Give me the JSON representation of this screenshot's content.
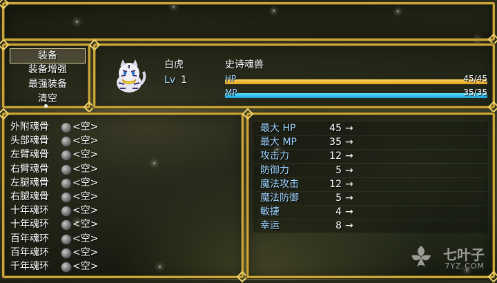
{
  "commands": [
    "装备",
    "装备增强",
    "最强装备",
    "清空"
  ],
  "actor": {
    "name": "白虎",
    "level_label": "Lv",
    "level": "1",
    "class": "史诗魂兽",
    "hp_label": "HP",
    "hp_value": "45/45",
    "hp_fraction": 1.0,
    "mp_label": "MP",
    "mp_value": "35/35",
    "mp_fraction": 1.0
  },
  "slots": [
    {
      "name": "外附魂骨",
      "item": "<空>"
    },
    {
      "name": "头部魂骨",
      "item": "<空>"
    },
    {
      "name": "左臂魂骨",
      "item": "<空>"
    },
    {
      "name": "右臂魂骨",
      "item": "<空>"
    },
    {
      "name": "左腿魂骨",
      "item": "<空>"
    },
    {
      "name": "右腿魂骨",
      "item": "<空>"
    },
    {
      "name": "十年魂环",
      "item": "<空>"
    },
    {
      "name": "十年魂环",
      "item": "<空>"
    },
    {
      "name": "百年魂环",
      "item": "<空>"
    },
    {
      "name": "百年魂环",
      "item": "<空>"
    },
    {
      "name": "千年魂环",
      "item": "<空>"
    }
  ],
  "params": [
    {
      "name": "最大 HP",
      "value": "45",
      "arrow": "→"
    },
    {
      "name": "最大 MP",
      "value": "35",
      "arrow": "→"
    },
    {
      "name": "攻击力",
      "value": "12",
      "arrow": "→"
    },
    {
      "name": "防御力",
      "value": "5",
      "arrow": "→"
    },
    {
      "name": "魔法攻击",
      "value": "12",
      "arrow": "→"
    },
    {
      "name": "魔法防御",
      "value": "5",
      "arrow": "→"
    },
    {
      "name": "敏捷",
      "value": "4",
      "arrow": "→"
    },
    {
      "name": "幸运",
      "value": "8",
      "arrow": "→"
    }
  ],
  "watermark": {
    "text": "七叶子",
    "sub": "7YZ.COM"
  },
  "colors": {
    "frame": "#c9a63c",
    "hp": "#f0b83a",
    "mp": "#2fbde8",
    "system_text": "#9fd6ff"
  }
}
